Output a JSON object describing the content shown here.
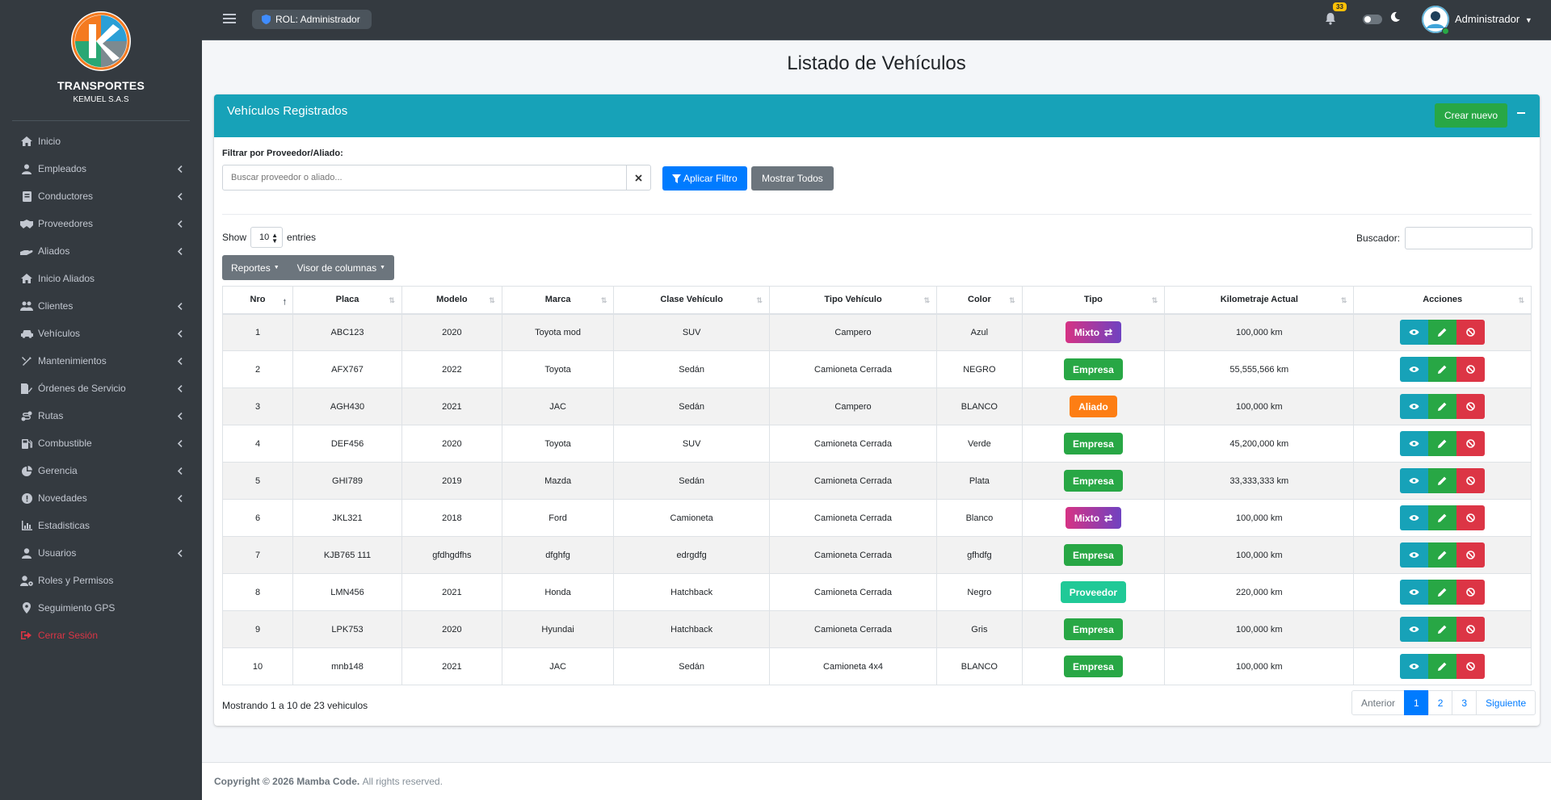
{
  "brand": {
    "title": "TRANSPORTES",
    "subtitle": "KEMUEL S.A.S"
  },
  "sidebar": {
    "items": [
      {
        "label": "Inicio",
        "icon": "home-icon",
        "expandable": false
      },
      {
        "label": "Empleados",
        "icon": "user-tie-icon",
        "expandable": true
      },
      {
        "label": "Conductores",
        "icon": "id-card-icon",
        "expandable": true
      },
      {
        "label": "Proveedores",
        "icon": "handshake-icon",
        "expandable": true
      },
      {
        "label": "Aliados",
        "icon": "hand-holding-icon",
        "expandable": true
      },
      {
        "label": "Inicio Aliados",
        "icon": "home-icon",
        "expandable": false
      },
      {
        "label": "Clientes",
        "icon": "users-icon",
        "expandable": true
      },
      {
        "label": "Vehículos",
        "icon": "car-icon",
        "expandable": true
      },
      {
        "label": "Mantenimientos",
        "icon": "tools-icon",
        "expandable": true
      },
      {
        "label": "Órdenes de Servicio",
        "icon": "file-signature-icon",
        "expandable": true
      },
      {
        "label": "Rutas",
        "icon": "route-icon",
        "expandable": true
      },
      {
        "label": "Combustible",
        "icon": "gas-pump-icon",
        "expandable": true
      },
      {
        "label": "Gerencia",
        "icon": "pie-chart-icon",
        "expandable": true
      },
      {
        "label": "Novedades",
        "icon": "exclamation-circle-icon",
        "expandable": true
      },
      {
        "label": "Estadisticas",
        "icon": "bar-chart-icon",
        "expandable": false
      },
      {
        "label": "Usuarios",
        "icon": "user-icon",
        "expandable": true
      },
      {
        "label": "Roles y Permisos",
        "icon": "user-cog-icon",
        "expandable": false
      },
      {
        "label": "Seguimiento GPS",
        "icon": "map-marker-icon",
        "expandable": false
      }
    ],
    "logout": "Cerrar Sesión"
  },
  "topbar": {
    "role": "ROL: Administrador",
    "notifications": "33",
    "user": "Administrador"
  },
  "page": {
    "title": "Listado de Vehículos"
  },
  "card": {
    "title": "Vehículos Registrados",
    "create_label": "Crear nuevo",
    "filter_label": "Filtrar por Proveedor/Aliado:",
    "filter_placeholder": "Buscar proveedor o aliado...",
    "apply_filter": "Aplicar Filtro",
    "show_all": "Mostrar Todos",
    "show_label": "Show",
    "entries_value": "10",
    "entries_label": "entries",
    "search_label": "Buscador:",
    "reports_label": "Reportes",
    "columns_label": "Visor de columnas"
  },
  "table": {
    "headers": [
      "Nro",
      "Placa",
      "Modelo",
      "Marca",
      "Clase Vehículo",
      "Tipo Vehículo",
      "Color",
      "Tipo",
      "Kilometraje Actual",
      "Acciones"
    ],
    "rows": [
      {
        "nro": "1",
        "placa": "ABC123",
        "modelo": "2020",
        "marca": "Toyota mod",
        "clase": "SUV",
        "tipo_vehiculo": "Campero",
        "color": "Azul",
        "tipo": "Mixto",
        "km": "100,000 km"
      },
      {
        "nro": "2",
        "placa": "AFX767",
        "modelo": "2022",
        "marca": "Toyota",
        "clase": "Sedán",
        "tipo_vehiculo": "Camioneta Cerrada",
        "color": "NEGRO",
        "tipo": "Empresa",
        "km": "55,555,566 km"
      },
      {
        "nro": "3",
        "placa": "AGH430",
        "modelo": "2021",
        "marca": "JAC",
        "clase": "Sedán",
        "tipo_vehiculo": "Campero",
        "color": "BLANCO",
        "tipo": "Aliado",
        "km": "100,000 km"
      },
      {
        "nro": "4",
        "placa": "DEF456",
        "modelo": "2020",
        "marca": "Toyota",
        "clase": "SUV",
        "tipo_vehiculo": "Camioneta Cerrada",
        "color": "Verde",
        "tipo": "Empresa",
        "km": "45,200,000 km"
      },
      {
        "nro": "5",
        "placa": "GHI789",
        "modelo": "2019",
        "marca": "Mazda",
        "clase": "Sedán",
        "tipo_vehiculo": "Camioneta Cerrada",
        "color": "Plata",
        "tipo": "Empresa",
        "km": "33,333,333 km"
      },
      {
        "nro": "6",
        "placa": "JKL321",
        "modelo": "2018",
        "marca": "Ford",
        "clase": "Camioneta",
        "tipo_vehiculo": "Camioneta Cerrada",
        "color": "Blanco",
        "tipo": "Mixto",
        "km": "100,000 km"
      },
      {
        "nro": "7",
        "placa": "KJB765 111",
        "modelo": "gfdhgdfhs",
        "marca": "dfghfg",
        "clase": "edrgdfg",
        "tipo_vehiculo": "Camioneta Cerrada",
        "color": "gfhdfg",
        "tipo": "Empresa",
        "km": "100,000 km"
      },
      {
        "nro": "8",
        "placa": "LMN456",
        "modelo": "2021",
        "marca": "Honda",
        "clase": "Hatchback",
        "tipo_vehiculo": "Camioneta Cerrada",
        "color": "Negro",
        "tipo": "Proveedor",
        "km": "220,000 km"
      },
      {
        "nro": "9",
        "placa": "LPK753",
        "modelo": "2020",
        "marca": "Hyundai",
        "clase": "Hatchback",
        "tipo_vehiculo": "Camioneta Cerrada",
        "color": "Gris",
        "tipo": "Empresa",
        "km": "100,000 km"
      },
      {
        "nro": "10",
        "placa": "mnb148",
        "modelo": "2021",
        "marca": "JAC",
        "clase": "Sedán",
        "tipo_vehiculo": "Camioneta 4x4",
        "color": "BLANCO",
        "tipo": "Empresa",
        "km": "100,000 km"
      }
    ]
  },
  "pagination": {
    "info": "Mostrando 1 a 10 de 23 vehiculos",
    "prev": "Anterior",
    "pages": [
      "1",
      "2",
      "3"
    ],
    "next": "Siguiente"
  },
  "footer": {
    "copyright": "Copyright © 2026 Mamba Code.",
    "rights": "All rights reserved."
  },
  "colors": {
    "sidebar": "#343a40",
    "card_header": "#17a2b8",
    "primary": "#007bff",
    "success": "#28a745",
    "danger": "#dc3545",
    "warning": "#fd7e14"
  }
}
